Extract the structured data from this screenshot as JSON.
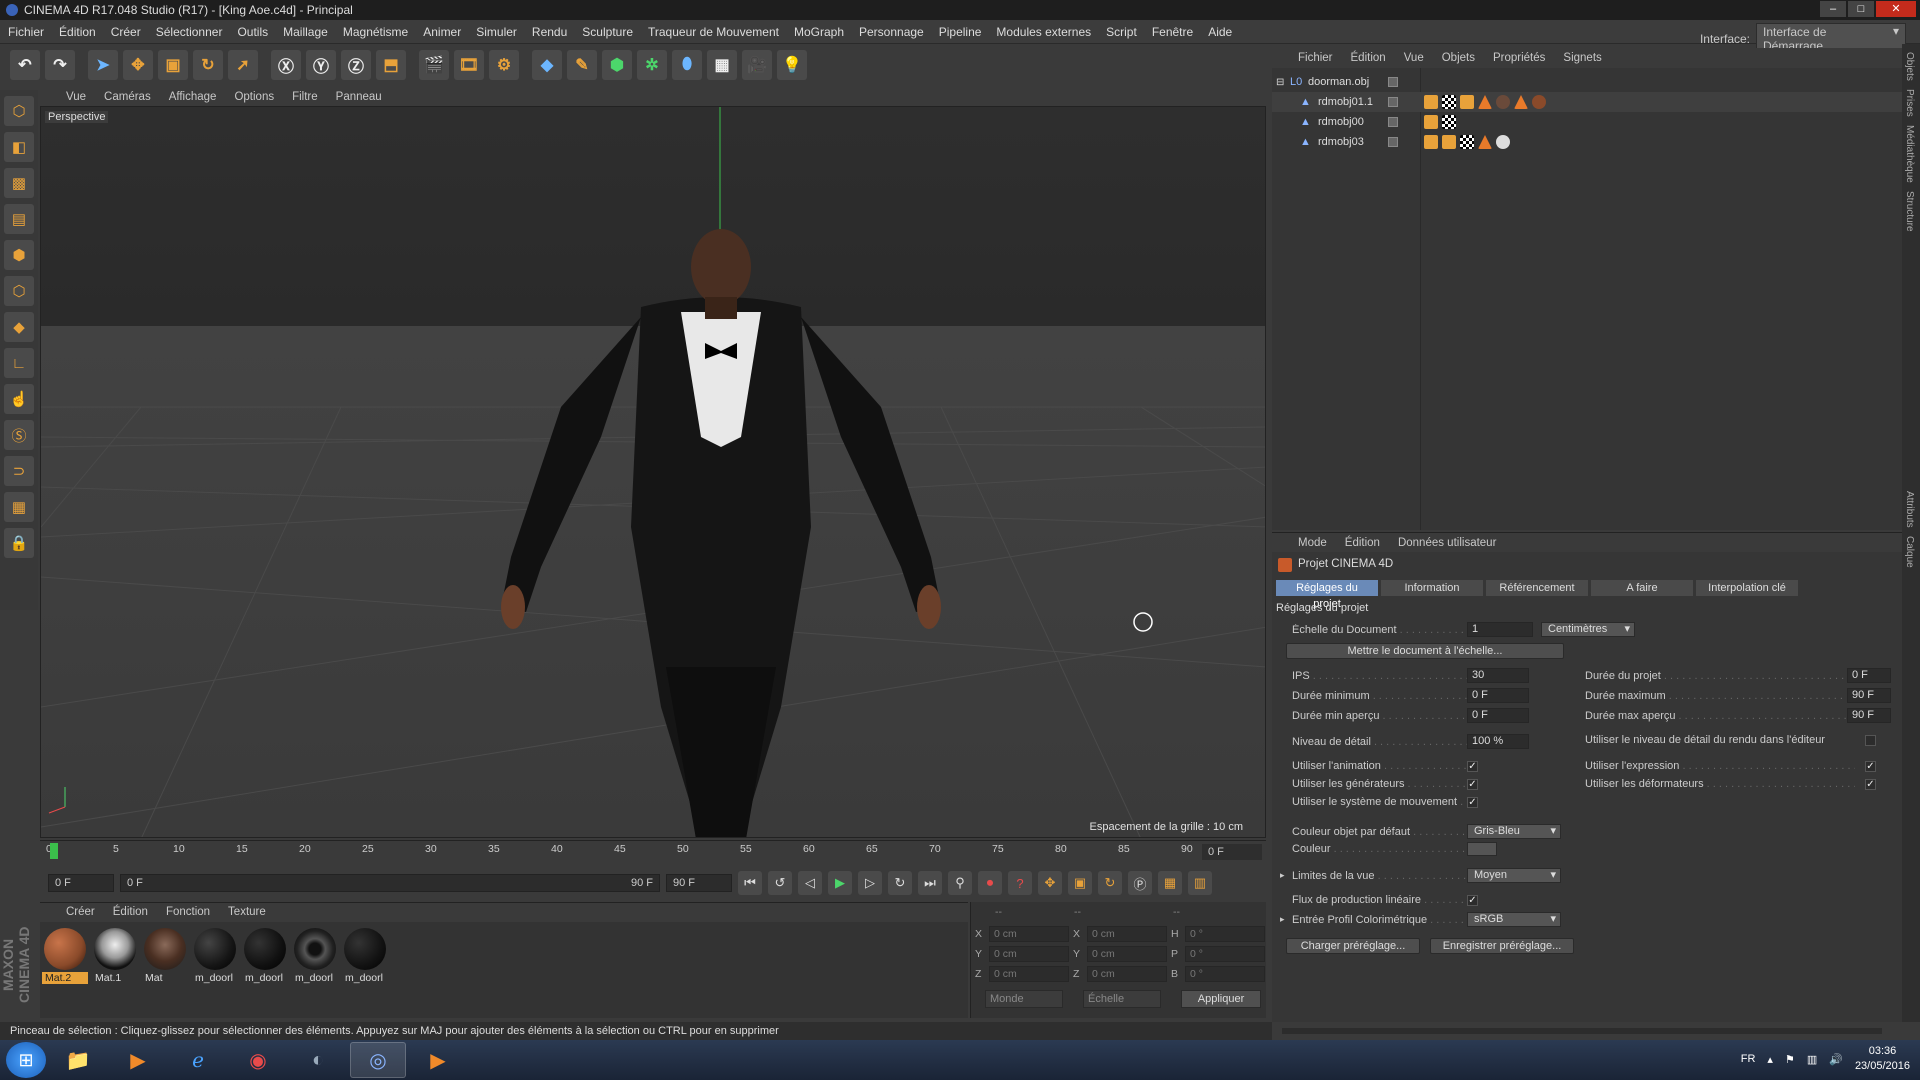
{
  "window": {
    "title": "CINEMA 4D R17.048 Studio (R17) - [King Aoe.c4d] - Principal",
    "min": "–",
    "max": "□",
    "close": "✕"
  },
  "menu": [
    "Fichier",
    "Édition",
    "Créer",
    "Sélectionner",
    "Outils",
    "Maillage",
    "Magnétisme",
    "Animer",
    "Simuler",
    "Rendu",
    "Sculpture",
    "Traqueur de Mouvement",
    "MoGraph",
    "Personnage",
    "Pipeline",
    "Modules externes",
    "Script",
    "Fenêtre",
    "Aide"
  ],
  "interface": {
    "label": "Interface:",
    "value": "Interface de Démarrage"
  },
  "viewport": {
    "menu": [
      "Vue",
      "Caméras",
      "Affichage",
      "Options",
      "Filtre",
      "Panneau"
    ],
    "camera": "Perspective",
    "grid": "Espacement de la grille : 10 cm"
  },
  "timeline": {
    "ticks": [
      "0",
      "5",
      "10",
      "15",
      "20",
      "25",
      "30",
      "35",
      "40",
      "45",
      "50",
      "55",
      "60",
      "65",
      "70",
      "75",
      "80",
      "85",
      "90"
    ],
    "end": "0 F"
  },
  "transport": {
    "start": "0 F",
    "range_start": "0 F",
    "range_end": "90 F",
    "max": "90 F"
  },
  "materials": {
    "menu": [
      "Créer",
      "Édition",
      "Fonction",
      "Texture"
    ],
    "items": [
      {
        "name": "Mat.2",
        "color": "#8a4a2a",
        "selected": true
      },
      {
        "name": "Mat.1",
        "color": "#c8c8c8"
      },
      {
        "name": "Mat",
        "color": "#6a4a3a"
      },
      {
        "name": "m_doorl",
        "color": "#151515"
      },
      {
        "name": "m_doorl",
        "color": "#101010"
      },
      {
        "name": "m_doorl",
        "color": "#222222"
      },
      {
        "name": "m_doorl",
        "color": "#121212"
      }
    ]
  },
  "coords": {
    "header": [
      "--",
      "--",
      "--"
    ],
    "rows": [
      {
        "a": "X",
        "av": "0 cm",
        "b": "X",
        "bv": "0 cm",
        "c": "H",
        "cv": "0 °"
      },
      {
        "a": "Y",
        "av": "0 cm",
        "b": "Y",
        "bv": "0 cm",
        "c": "P",
        "cv": "0 °"
      },
      {
        "a": "Z",
        "av": "0 cm",
        "b": "Z",
        "bv": "0 cm",
        "c": "B",
        "cv": "0 °"
      }
    ],
    "world": "Monde",
    "scale": "Échelle",
    "apply": "Appliquer"
  },
  "status": "Pinceau de sélection : Cliquez-glissez pour sélectionner des éléments. Appuyez sur MAJ pour ajouter des éléments à la sélection ou CTRL pour en supprimer",
  "objects": {
    "menu": [
      "Fichier",
      "Édition",
      "Vue",
      "Objets",
      "Propriétés",
      "Signets"
    ],
    "items": [
      {
        "name": "doorman.obj"
      },
      {
        "name": "rdmobj01.1"
      },
      {
        "name": "rdmobj00"
      },
      {
        "name": "rdmobj03"
      }
    ]
  },
  "attributes": {
    "menu": [
      "Mode",
      "Édition",
      "Données utilisateur"
    ],
    "title": "Projet CINEMA 4D",
    "tabs": [
      "Réglages du projet",
      "Information",
      "Référencement",
      "A faire",
      "Interpolation clé"
    ],
    "section": "Réglages du projet",
    "scale_label": "Échelle du Document",
    "scale_value": "1",
    "scale_unit": "Centimètres",
    "scale_button": "Mettre le document à l'échelle...",
    "ips_label": "IPS",
    "ips": "30",
    "dmin_label": "Durée minimum",
    "dmin": "0 F",
    "dminp_label": "Durée min aperçu",
    "dminp": "0 F",
    "dproj_label": "Durée du projet",
    "dproj": "0 F",
    "dmax_label": "Durée maximum",
    "dmax": "90 F",
    "dmaxp_label": "Durée max aperçu",
    "dmaxp": "90 F",
    "lod_label": "Niveau de détail",
    "lod": "100 %",
    "lod_render_label": "Utiliser le niveau de détail du rendu dans l'éditeur",
    "anim_label": "Utiliser l'animation",
    "gen_label": "Utiliser les générateurs",
    "motion_label": "Utiliser le système de mouvement",
    "expr_label": "Utiliser l'expression",
    "deform_label": "Utiliser les déformateurs",
    "color_def_label": "Couleur objet par défaut",
    "color_def": "Gris-Bleu",
    "color_label": "Couleur",
    "limits_label": "Limites de la vue",
    "limits": "Moyen",
    "linear_label": "Flux de production linéaire",
    "profile_label": "Entrée Profil Colorimétrique",
    "profile": "sRGB",
    "load": "Charger préréglage...",
    "save": "Enregistrer préréglage..."
  },
  "side_tabs": [
    "Objets",
    "Prises",
    "Médiathèque",
    "Structure",
    "Attributs",
    "Calque"
  ],
  "taskbar": {
    "lang": "FR",
    "time": "03:36",
    "date": "23/05/2016"
  }
}
